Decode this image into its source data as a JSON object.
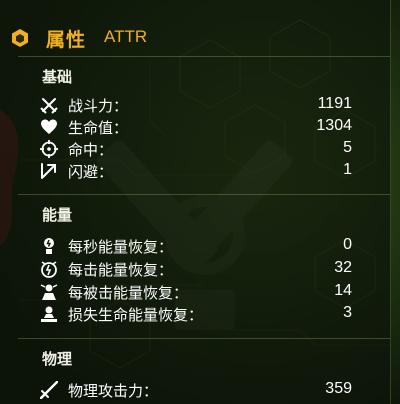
{
  "header": {
    "title": "属性",
    "subtitle": "ATTR",
    "icon": "hexagon-attr-icon"
  },
  "colors": {
    "accent": "#f2b01e",
    "text": "#ffffff",
    "background": "#0b1408"
  },
  "sections": [
    {
      "title": "基础",
      "rows": [
        {
          "icon": "crossed-swords-icon",
          "label": "战斗力：",
          "value": "1191"
        },
        {
          "icon": "heart-icon",
          "label": "生命值：",
          "value": "1304"
        },
        {
          "icon": "crosshair-icon",
          "label": "命中：",
          "value": "5"
        },
        {
          "icon": "dodge-arrow-icon",
          "label": "闪避：",
          "value": "1"
        }
      ]
    },
    {
      "title": "能量",
      "rows": [
        {
          "icon": "energy-per-second-icon",
          "label": "每秒能量恢复：",
          "value": "0"
        },
        {
          "icon": "energy-per-hit-icon",
          "label": "每击能量恢复：",
          "value": "32"
        },
        {
          "icon": "energy-when-hit-icon",
          "label": "每被击能量恢复：",
          "value": "14"
        },
        {
          "icon": "energy-hp-loss-icon",
          "label": "损失生命能量恢复：",
          "value": "3"
        }
      ]
    },
    {
      "title": "物理",
      "rows": [
        {
          "icon": "sword-icon",
          "label": "物理攻击力：",
          "value": "359"
        }
      ]
    }
  ]
}
